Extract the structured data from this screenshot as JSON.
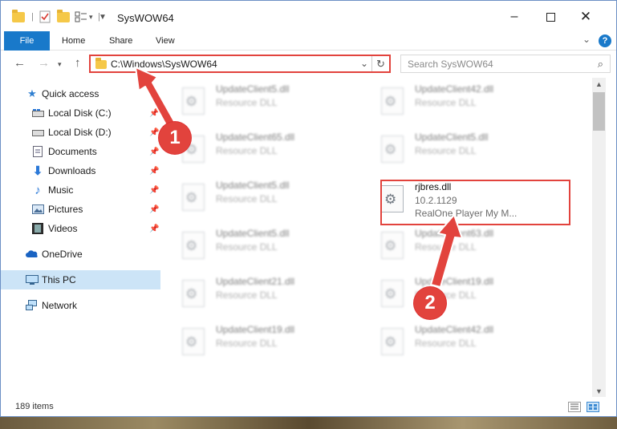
{
  "window": {
    "title": "SysWOW64"
  },
  "ribbon": {
    "tabs": [
      "File",
      "Home",
      "Share",
      "View"
    ],
    "help_label": "?"
  },
  "navigation": {
    "back_icon": "arrow-left-icon",
    "forward_icon": "arrow-right-icon",
    "recent_icon": "chevron-down-icon",
    "up_icon": "arrow-up-icon",
    "address": "C:\\Windows\\SysWOW64",
    "search_placeholder": "Search SysWOW64"
  },
  "sidebar": {
    "items": [
      {
        "label": "Quick access",
        "icon": "star-icon",
        "pinned": false,
        "selected": false
      },
      {
        "label": "Local Disk (C:)",
        "icon": "drive-icon",
        "pinned": true,
        "selected": false
      },
      {
        "label": "Local Disk (D:)",
        "icon": "drive-icon",
        "pinned": true,
        "selected": false
      },
      {
        "label": "Documents",
        "icon": "documents-icon",
        "pinned": true,
        "selected": false
      },
      {
        "label": "Downloads",
        "icon": "download-icon",
        "pinned": true,
        "selected": false
      },
      {
        "label": "Music",
        "icon": "music-icon",
        "pinned": true,
        "selected": false
      },
      {
        "label": "Pictures",
        "icon": "pictures-icon",
        "pinned": true,
        "selected": false
      },
      {
        "label": "Videos",
        "icon": "videos-icon",
        "pinned": true,
        "selected": false
      },
      {
        "label": "OneDrive",
        "icon": "cloud-icon",
        "pinned": false,
        "selected": false
      },
      {
        "label": "This PC",
        "icon": "computer-icon",
        "pinned": false,
        "selected": true
      },
      {
        "label": "Network",
        "icon": "network-icon",
        "pinned": false,
        "selected": false
      }
    ]
  },
  "files": [
    {
      "name": "UpdateClient5.dll",
      "type": "Resource DLL"
    },
    {
      "name": "UpdateClient42.dll",
      "type": "Resource DLL"
    },
    {
      "name": "UpdateClient65.dll",
      "type": "Resource DLL"
    },
    {
      "name": "UpdateClient5.dll",
      "type": "Resource DLL"
    },
    {
      "name": "UpdateClient5.dll",
      "type": "Resource DLL"
    },
    {
      "name": "rjbres.dll",
      "version": "10.2.1129",
      "description": "RealOne Player My M..."
    },
    {
      "name": "UpdateClient5.dll",
      "type": "Resource DLL"
    },
    {
      "name": "UpdateClient63.dll",
      "type": "Resource DLL"
    },
    {
      "name": "UpdateClient21.dll",
      "type": "Resource DLL"
    },
    {
      "name": "UpdateClient19.dll",
      "type": "Resource DLL"
    },
    {
      "name": "UpdateClient19.dll",
      "type": "Resource DLL"
    },
    {
      "name": "UpdateClient42.dll",
      "type": "Resource DLL"
    }
  ],
  "status": {
    "item_count": "189 items"
  },
  "annotations": {
    "step1": "1",
    "step2": "2",
    "color": "#e2433d"
  }
}
